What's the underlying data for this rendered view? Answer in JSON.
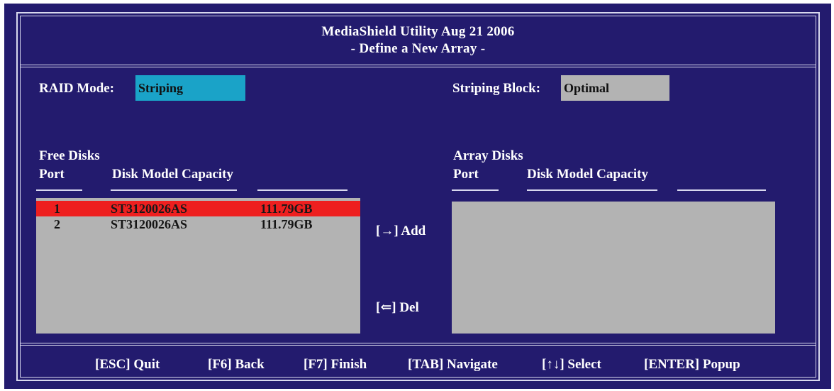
{
  "header": {
    "title_line1": "MediaShield Utility  Aug 21 2006",
    "title_line2": "- Define a New Array -"
  },
  "settings": {
    "raid_mode_label": "RAID Mode:",
    "raid_mode_value": "Striping",
    "striping_block_label": "Striping Block:",
    "striping_block_value": "Optimal"
  },
  "free_disks": {
    "section_title": "Free Disks",
    "col_port": "Port",
    "col_model_capacity": "Disk  Model Capacity",
    "rows": [
      {
        "port": "1",
        "model": "ST3120026AS",
        "capacity": "111.79GB",
        "selected": true
      },
      {
        "port": "2",
        "model": "ST3120026AS",
        "capacity": "111.79GB",
        "selected": false
      }
    ]
  },
  "array_disks": {
    "section_title": "Array Disks",
    "col_port": "Port",
    "col_model_capacity": "Disk  Model Capacity",
    "rows": []
  },
  "actions": {
    "add": "[→] Add",
    "del": "[⇐] Del"
  },
  "footer": {
    "quit": "[ESC] Quit",
    "back": "[F6] Back",
    "finish": "[F7] Finish",
    "navigate": "[TAB] Navigate",
    "select": "[↑↓] Select",
    "popup": "[ENTER] Popup"
  },
  "colors": {
    "background": "#231b6e",
    "raid_field": "#1aa3c8",
    "block_field": "#b3b3b3",
    "list_bg": "#b3b3b3",
    "selection": "#ee1f1f"
  }
}
